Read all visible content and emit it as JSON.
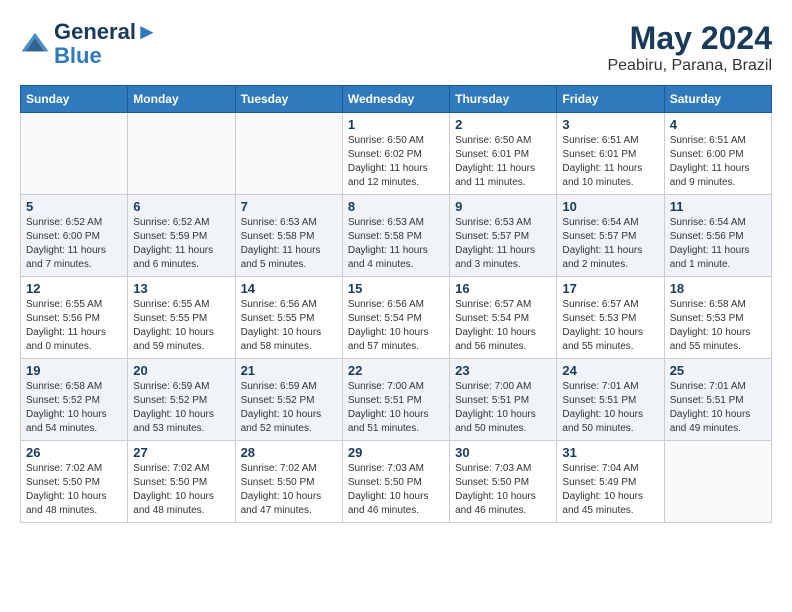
{
  "header": {
    "logo_line1": "General",
    "logo_line2": "Blue",
    "month_year": "May 2024",
    "location": "Peabiru, Parana, Brazil"
  },
  "calendar": {
    "days_of_week": [
      "Sunday",
      "Monday",
      "Tuesday",
      "Wednesday",
      "Thursday",
      "Friday",
      "Saturday"
    ],
    "weeks": [
      [
        {
          "day": "",
          "detail": ""
        },
        {
          "day": "",
          "detail": ""
        },
        {
          "day": "",
          "detail": ""
        },
        {
          "day": "1",
          "detail": "Sunrise: 6:50 AM\nSunset: 6:02 PM\nDaylight: 11 hours and 12 minutes."
        },
        {
          "day": "2",
          "detail": "Sunrise: 6:50 AM\nSunset: 6:01 PM\nDaylight: 11 hours and 11 minutes."
        },
        {
          "day": "3",
          "detail": "Sunrise: 6:51 AM\nSunset: 6:01 PM\nDaylight: 11 hours and 10 minutes."
        },
        {
          "day": "4",
          "detail": "Sunrise: 6:51 AM\nSunset: 6:00 PM\nDaylight: 11 hours and 9 minutes."
        }
      ],
      [
        {
          "day": "5",
          "detail": "Sunrise: 6:52 AM\nSunset: 6:00 PM\nDaylight: 11 hours and 7 minutes."
        },
        {
          "day": "6",
          "detail": "Sunrise: 6:52 AM\nSunset: 5:59 PM\nDaylight: 11 hours and 6 minutes."
        },
        {
          "day": "7",
          "detail": "Sunrise: 6:53 AM\nSunset: 5:58 PM\nDaylight: 11 hours and 5 minutes."
        },
        {
          "day": "8",
          "detail": "Sunrise: 6:53 AM\nSunset: 5:58 PM\nDaylight: 11 hours and 4 minutes."
        },
        {
          "day": "9",
          "detail": "Sunrise: 6:53 AM\nSunset: 5:57 PM\nDaylight: 11 hours and 3 minutes."
        },
        {
          "day": "10",
          "detail": "Sunrise: 6:54 AM\nSunset: 5:57 PM\nDaylight: 11 hours and 2 minutes."
        },
        {
          "day": "11",
          "detail": "Sunrise: 6:54 AM\nSunset: 5:56 PM\nDaylight: 11 hours and 1 minute."
        }
      ],
      [
        {
          "day": "12",
          "detail": "Sunrise: 6:55 AM\nSunset: 5:56 PM\nDaylight: 11 hours and 0 minutes."
        },
        {
          "day": "13",
          "detail": "Sunrise: 6:55 AM\nSunset: 5:55 PM\nDaylight: 10 hours and 59 minutes."
        },
        {
          "day": "14",
          "detail": "Sunrise: 6:56 AM\nSunset: 5:55 PM\nDaylight: 10 hours and 58 minutes."
        },
        {
          "day": "15",
          "detail": "Sunrise: 6:56 AM\nSunset: 5:54 PM\nDaylight: 10 hours and 57 minutes."
        },
        {
          "day": "16",
          "detail": "Sunrise: 6:57 AM\nSunset: 5:54 PM\nDaylight: 10 hours and 56 minutes."
        },
        {
          "day": "17",
          "detail": "Sunrise: 6:57 AM\nSunset: 5:53 PM\nDaylight: 10 hours and 55 minutes."
        },
        {
          "day": "18",
          "detail": "Sunrise: 6:58 AM\nSunset: 5:53 PM\nDaylight: 10 hours and 55 minutes."
        }
      ],
      [
        {
          "day": "19",
          "detail": "Sunrise: 6:58 AM\nSunset: 5:52 PM\nDaylight: 10 hours and 54 minutes."
        },
        {
          "day": "20",
          "detail": "Sunrise: 6:59 AM\nSunset: 5:52 PM\nDaylight: 10 hours and 53 minutes."
        },
        {
          "day": "21",
          "detail": "Sunrise: 6:59 AM\nSunset: 5:52 PM\nDaylight: 10 hours and 52 minutes."
        },
        {
          "day": "22",
          "detail": "Sunrise: 7:00 AM\nSunset: 5:51 PM\nDaylight: 10 hours and 51 minutes."
        },
        {
          "day": "23",
          "detail": "Sunrise: 7:00 AM\nSunset: 5:51 PM\nDaylight: 10 hours and 50 minutes."
        },
        {
          "day": "24",
          "detail": "Sunrise: 7:01 AM\nSunset: 5:51 PM\nDaylight: 10 hours and 50 minutes."
        },
        {
          "day": "25",
          "detail": "Sunrise: 7:01 AM\nSunset: 5:51 PM\nDaylight: 10 hours and 49 minutes."
        }
      ],
      [
        {
          "day": "26",
          "detail": "Sunrise: 7:02 AM\nSunset: 5:50 PM\nDaylight: 10 hours and 48 minutes."
        },
        {
          "day": "27",
          "detail": "Sunrise: 7:02 AM\nSunset: 5:50 PM\nDaylight: 10 hours and 48 minutes."
        },
        {
          "day": "28",
          "detail": "Sunrise: 7:02 AM\nSunset: 5:50 PM\nDaylight: 10 hours and 47 minutes."
        },
        {
          "day": "29",
          "detail": "Sunrise: 7:03 AM\nSunset: 5:50 PM\nDaylight: 10 hours and 46 minutes."
        },
        {
          "day": "30",
          "detail": "Sunrise: 7:03 AM\nSunset: 5:50 PM\nDaylight: 10 hours and 46 minutes."
        },
        {
          "day": "31",
          "detail": "Sunrise: 7:04 AM\nSunset: 5:49 PM\nDaylight: 10 hours and 45 minutes."
        },
        {
          "day": "",
          "detail": ""
        }
      ]
    ]
  }
}
